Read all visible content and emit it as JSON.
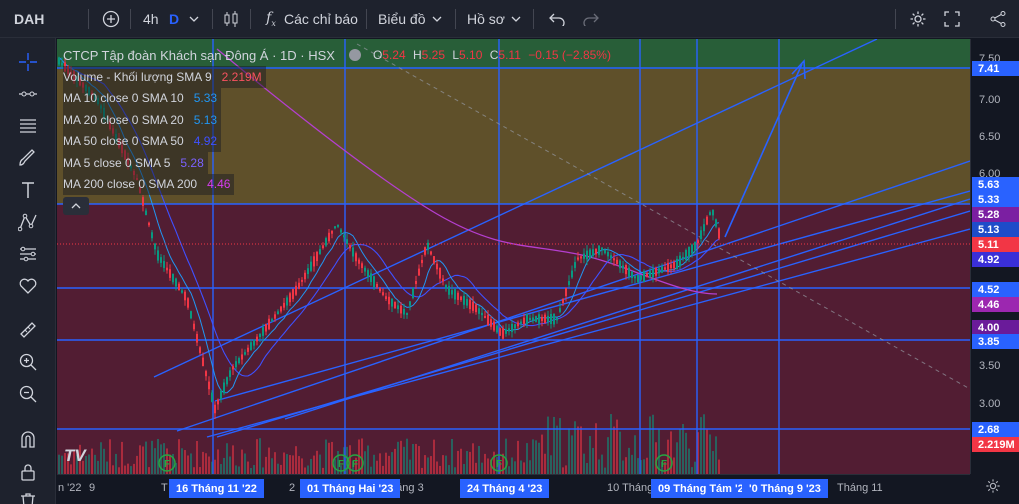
{
  "toolbar": {
    "symbol": "DAH",
    "interval": "4h",
    "interval_flag": "D",
    "indicators_label": "Các chỉ báo",
    "chart_type_label": "Biểu đồ",
    "profile_label": "Hồ sơ"
  },
  "legend": {
    "title": "CTCP Tập đoàn Khách sạn Đông Á · 1D · HSX",
    "ohlc": {
      "o_key": "O",
      "o_val": "5.24",
      "h_key": "H",
      "h_val": "5.25",
      "l_key": "L",
      "l_val": "5.10",
      "c_key": "C",
      "c_val": "5.11",
      "change": "−0.15 (−2.85%)"
    },
    "indicators": [
      {
        "name": "Volume - Khối lượng SMA 9",
        "value": "2.219M",
        "color": "#f7525f"
      },
      {
        "name": "MA 10 close 0 SMA 10",
        "value": "5.33",
        "color": "#2196f3"
      },
      {
        "name": "MA 20 close 0 SMA 20",
        "value": "5.13",
        "color": "#2196f3"
      },
      {
        "name": "MA 50 close 0 SMA 50",
        "value": "4.92",
        "color": "#3f51ff"
      },
      {
        "name": "MA 5 close 0 SMA 5",
        "value": "5.28",
        "color": "#7b61ff"
      },
      {
        "name": "MA 200 close 0 SMA 200",
        "value": "4.46",
        "color": "#d63cf0"
      }
    ]
  },
  "price_axis": {
    "ticks": [
      "7.50",
      "7.00",
      "6.50",
      "6.00",
      "3.50",
      "3.00"
    ],
    "badges": [
      {
        "text": "7.41",
        "color": "#2962ff"
      },
      {
        "text": "5.63",
        "color": "#2962ff"
      },
      {
        "text": "5.33",
        "color": "#2962ff"
      },
      {
        "text": "5.28",
        "color": "#7b1fa2"
      },
      {
        "text": "5.13",
        "color": "#1e4cc9"
      },
      {
        "text": "5.11",
        "color": "#f23645"
      },
      {
        "text": "4.92",
        "color": "#3a2fd8"
      },
      {
        "text": "4.52",
        "color": "#2962ff"
      },
      {
        "text": "4.46",
        "color": "#9c27b0"
      },
      {
        "text": "4.00",
        "color": "#6a1b9a"
      },
      {
        "text": "3.85",
        "color": "#2962ff"
      },
      {
        "text": "2.68",
        "color": "#2962ff"
      },
      {
        "text": "2.219M",
        "color": "#f23645"
      }
    ]
  },
  "time_axis": {
    "labels": [
      "n '22",
      "9",
      "T",
      "2",
      "tháng 3",
      "10 Tháng",
      "Tháng 11"
    ],
    "badges": [
      "16 Tháng 11 '22",
      "01 Tháng Hai '23",
      "24 Tháng 4 '23",
      "09 Tháng Tám '23",
      "'0 Tháng 9 '23"
    ]
  },
  "colors": {
    "accent": "#2962ff",
    "up": "#f23645",
    "down": "#089981",
    "zone_top": "#2d6b3c",
    "zone_mid": "#6d5a2b",
    "zone_low": "#5e1f36"
  },
  "icons": [
    "add-symbol-icon",
    "bar-style-icon",
    "fx-icon",
    "undo-icon",
    "redo-icon",
    "settings-icon",
    "fullscreen-icon",
    "share-icon"
  ]
}
